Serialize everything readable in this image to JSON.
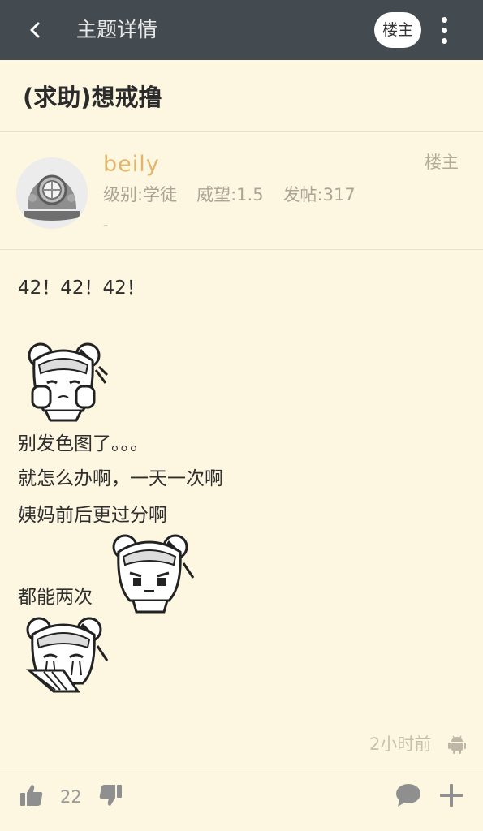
{
  "appbar": {
    "title": "主题详情",
    "op_chip": "楼主",
    "back_icon": "chevron-left-icon",
    "more_icon": "more-vertical-icon"
  },
  "topic": {
    "title": "(求助)想戒撸"
  },
  "author": {
    "name": "beily",
    "level": "级别:学徒",
    "prestige": "威望:1.5",
    "posts": "发帖:317",
    "signature": "-",
    "op_label": "楼主",
    "avatar_icon": "diving-helmet-avatar"
  },
  "post": {
    "line1": "42！42！42！",
    "line2": "别发色图了。。。",
    "line3": "就怎么办啊，一天一次啊",
    "line4": "姨妈前后更过分啊",
    "line5": "都能两次",
    "stickers": [
      "crying-girl-sticker",
      "annoyed-girl-sticker",
      "sobbing-girl-sticker"
    ],
    "time": "2小时前",
    "device_icon": "android-icon"
  },
  "actions": {
    "like_count": "22",
    "like_icon": "thumbs-up-icon",
    "dislike_icon": "thumbs-down-icon",
    "comment_icon": "comment-icon",
    "add_icon": "plus-icon"
  },
  "colors": {
    "appbar_bg": "#444b50",
    "page_bg": "#fdf6e0",
    "author_name": "#e3b56b",
    "muted": "#aaa595"
  }
}
